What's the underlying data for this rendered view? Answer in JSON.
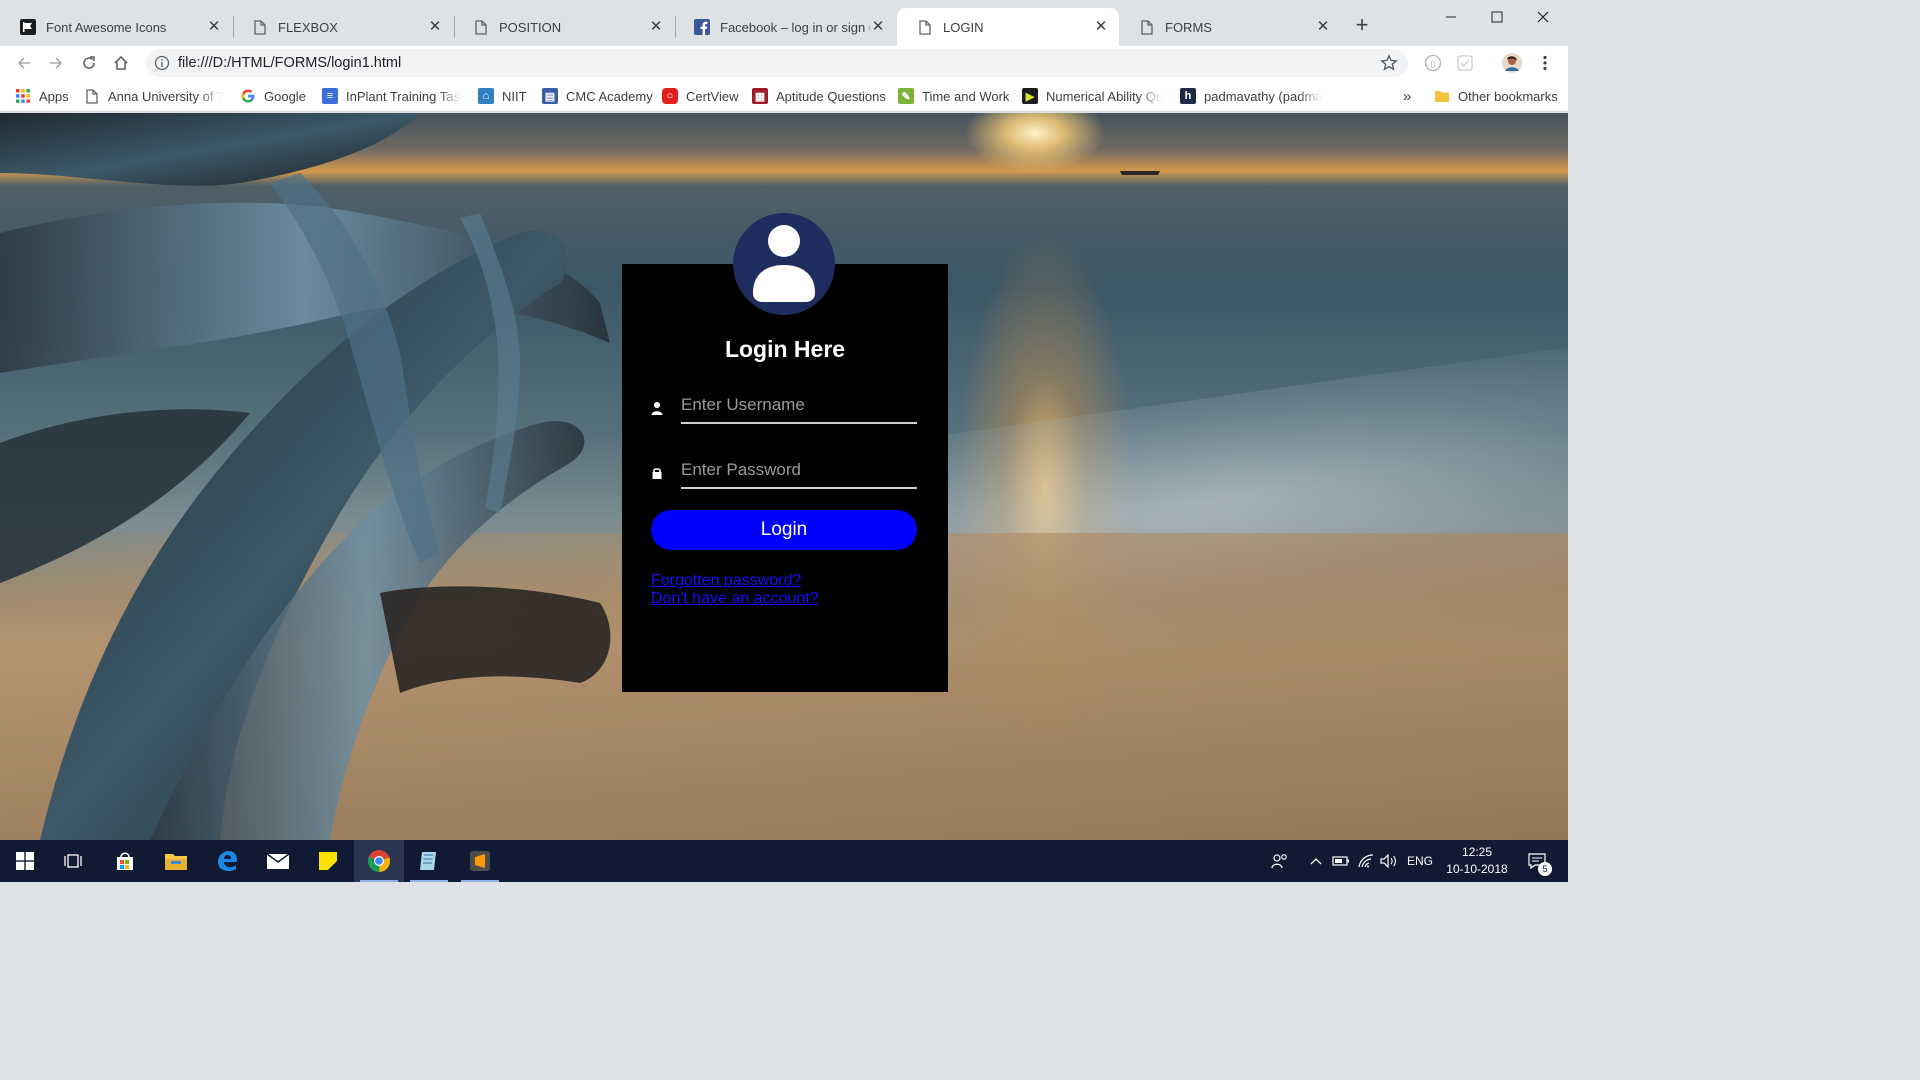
{
  "browser": {
    "tabs": [
      {
        "title": "Font Awesome Icons",
        "icon": "font-awesome-favicon"
      },
      {
        "title": "FLEXBOX",
        "icon": "page-icon"
      },
      {
        "title": "POSITION",
        "icon": "page-icon"
      },
      {
        "title": "Facebook – log in or sign up",
        "icon": "facebook-favicon"
      },
      {
        "title": "LOGIN",
        "icon": "page-icon",
        "active": true
      },
      {
        "title": "FORMS",
        "icon": "page-icon"
      }
    ],
    "url": "file:///D:/HTML/FORMS/login1.html",
    "bookmarks": [
      {
        "label": "Apps",
        "icon": "apps-grid-icon"
      },
      {
        "label": "Anna University of Te",
        "icon": "page-icon"
      },
      {
        "label": "Google",
        "icon": "google-icon"
      },
      {
        "label": "InPlant Training Tasks",
        "icon": "inplant-icon"
      },
      {
        "label": "NIIT",
        "icon": "niit-icon"
      },
      {
        "label": "CMC Academy",
        "icon": "cmc-icon"
      },
      {
        "label": "CertView",
        "icon": "certview-icon"
      },
      {
        "label": "Aptitude Questions",
        "icon": "aptitude-icon"
      },
      {
        "label": "Time and Work",
        "icon": "time-work-icon"
      },
      {
        "label": "Numerical Ability Qu",
        "icon": "numerical-icon"
      },
      {
        "label": "padmavathy (padma",
        "icon": "h-icon"
      }
    ],
    "overflow_label": "»",
    "other_bookmarks": "Other bookmarks"
  },
  "login": {
    "title": "Login Here",
    "username_placeholder": "Enter Username",
    "password_placeholder": "Enter Password",
    "button_label": "Login",
    "forgot_link": "Forgotten password?",
    "signup_link": "Don't have an account?"
  },
  "taskbar": {
    "language": "ENG",
    "time": "12:25",
    "date": "10-10-2018",
    "notification_count": "5"
  },
  "colors": {
    "login_button": "#0000ff",
    "avatar_bg": "#1f2c5e",
    "card_bg": "#000000",
    "link": "#1a0dff",
    "taskbar_bg": "#101a33"
  }
}
